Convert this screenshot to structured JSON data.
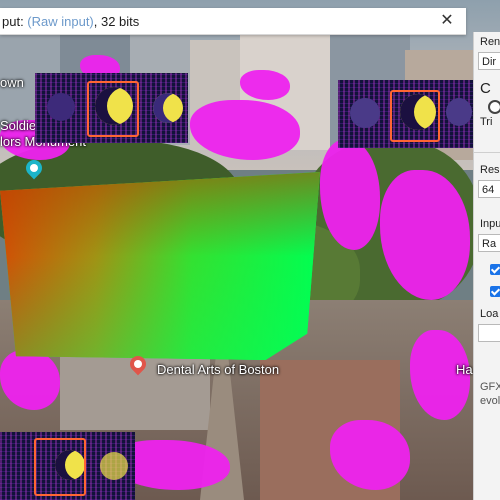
{
  "dialog": {
    "title_prefix": "put: ",
    "title_highlight": "(Raw input)",
    "title_suffix": ", 32 bits",
    "close_glyph": "✕"
  },
  "panel": {
    "texts": [
      "Ren",
      "Dir",
      "C",
      "Tri",
      "Res",
      "64",
      "Inpu",
      "Ra",
      "Loa",
      "GFXT",
      "evolu"
    ]
  },
  "map": {
    "label_town": "own",
    "label_monument_line1": "Soldiers and",
    "label_monument_line2": "lors Monument",
    "label_dental": "Dental Arts of Boston",
    "label_ha": "Ha"
  },
  "colors": {
    "accent_magenta": "#ee22ee",
    "select_orange": "#ff6633",
    "check_blue": "#1a73e8",
    "pin_red": "#e0554a",
    "pin_teal": "#1cb5c9"
  },
  "icons": {
    "close": "close-icon",
    "pin_monument": "map-pin-icon",
    "pin_dental": "map-pin-icon",
    "check": "checkbox-icon"
  }
}
